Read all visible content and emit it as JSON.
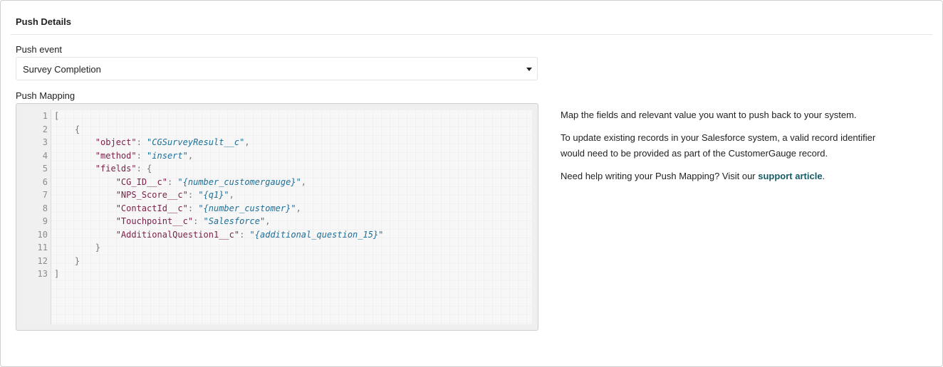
{
  "panel": {
    "title": "Push Details"
  },
  "push_event": {
    "label": "Push event",
    "selected": "Survey Completion"
  },
  "push_mapping": {
    "label": "Push Mapping",
    "lines": [
      {
        "n": "1",
        "indent": "",
        "parts": [
          {
            "t": "[",
            "c": "p"
          }
        ]
      },
      {
        "n": "2",
        "indent": "    ",
        "parts": [
          {
            "t": "{",
            "c": "p"
          }
        ]
      },
      {
        "n": "3",
        "indent": "        ",
        "parts": [
          {
            "t": "\"object\"",
            "c": "k"
          },
          {
            "t": ": ",
            "c": "p"
          },
          {
            "t": "\"CGSurveyResult__c\"",
            "c": "s"
          },
          {
            "t": ",",
            "c": "p"
          }
        ]
      },
      {
        "n": "4",
        "indent": "        ",
        "parts": [
          {
            "t": "\"method\"",
            "c": "k"
          },
          {
            "t": ": ",
            "c": "p"
          },
          {
            "t": "\"insert\"",
            "c": "s"
          },
          {
            "t": ",",
            "c": "p"
          }
        ]
      },
      {
        "n": "5",
        "indent": "        ",
        "parts": [
          {
            "t": "\"fields\"",
            "c": "k"
          },
          {
            "t": ": {",
            "c": "p"
          }
        ]
      },
      {
        "n": "6",
        "indent": "            ",
        "parts": [
          {
            "t": "\"CG_ID__c\"",
            "c": "k"
          },
          {
            "t": ": ",
            "c": "p"
          },
          {
            "t": "\"{number_customergauge}\"",
            "c": "s"
          },
          {
            "t": ",",
            "c": "p"
          }
        ]
      },
      {
        "n": "7",
        "indent": "            ",
        "parts": [
          {
            "t": "\"NPS_Score__c\"",
            "c": "k"
          },
          {
            "t": ": ",
            "c": "p"
          },
          {
            "t": "\"{q1}\"",
            "c": "s"
          },
          {
            "t": ",",
            "c": "p"
          }
        ]
      },
      {
        "n": "8",
        "indent": "            ",
        "parts": [
          {
            "t": "\"ContactId__c\"",
            "c": "k"
          },
          {
            "t": ": ",
            "c": "p"
          },
          {
            "t": "\"{number_customer}\"",
            "c": "s"
          },
          {
            "t": ",",
            "c": "p"
          }
        ]
      },
      {
        "n": "9",
        "indent": "            ",
        "parts": [
          {
            "t": "\"Touchpoint__c\"",
            "c": "k"
          },
          {
            "t": ": ",
            "c": "p"
          },
          {
            "t": "\"Salesforce\"",
            "c": "s"
          },
          {
            "t": ",",
            "c": "p"
          }
        ]
      },
      {
        "n": "10",
        "indent": "            ",
        "parts": [
          {
            "t": "\"AdditionalQuestion1__c\"",
            "c": "k"
          },
          {
            "t": ": ",
            "c": "p"
          },
          {
            "t": "\"{additional_question_15}\"",
            "c": "s"
          }
        ]
      },
      {
        "n": "11",
        "indent": "        ",
        "parts": [
          {
            "t": "}",
            "c": "p"
          }
        ]
      },
      {
        "n": "12",
        "indent": "    ",
        "parts": [
          {
            "t": "}",
            "c": "p"
          }
        ]
      },
      {
        "n": "13",
        "indent": "",
        "parts": [
          {
            "t": "]",
            "c": "p"
          }
        ]
      }
    ]
  },
  "help": {
    "p1": "Map the fields and relevant value you want to push back to your system.",
    "p2_line1": "To update existing records in your Salesforce system, a valid record identifier",
    "p2_line2": "would need to be provided as part of the CustomerGauge record.",
    "p3_prefix": "Need help writing your Push Mapping? Visit our ",
    "p3_link": "support article",
    "p3_suffix": "."
  },
  "icons": {
    "select_caret": "caret-down-icon"
  },
  "colors": {
    "key": "#7a1f48",
    "string": "#1d6f98",
    "link": "#145c66"
  }
}
